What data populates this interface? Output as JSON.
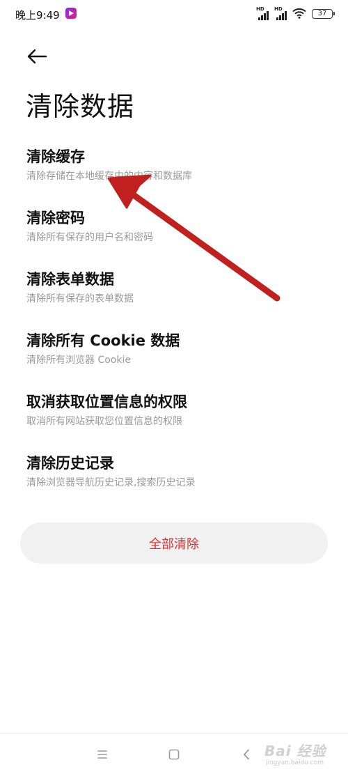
{
  "status_bar": {
    "time": "晚上9:49",
    "signal_1_label": "HD",
    "signal_2_label": "HD",
    "battery": "37"
  },
  "header": {
    "back_icon": "arrow-left-icon",
    "title": "清除数据"
  },
  "items": [
    {
      "title": "清除缓存",
      "desc": "清除存储在本地缓存中的内容和数据库"
    },
    {
      "title": "清除密码",
      "desc": "清除所有保存的用户名和密码"
    },
    {
      "title": "清除表单数据",
      "desc": "清除所有保存的表单数据"
    },
    {
      "title": "清除所有 Cookie 数据",
      "desc": "清除所有浏览器 Cookie"
    },
    {
      "title": "取消获取位置信息的权限",
      "desc": "取消所有网站获取您位置信息的权限"
    },
    {
      "title": "清除历史记录",
      "desc": "清除浏览器导航历史记录,搜索历史记录"
    }
  ],
  "clear_all": {
    "label": "全部清除",
    "color": "#e03131"
  },
  "annotation_arrow": {
    "color": "#c0211f"
  },
  "nav_bar": {
    "menu_icon": "menu-icon",
    "home_icon": "square-home-icon",
    "back_icon": "chevron-left-icon"
  },
  "watermark": {
    "main": "Bai 经验",
    "sub": "jingyan.baidu.com"
  }
}
